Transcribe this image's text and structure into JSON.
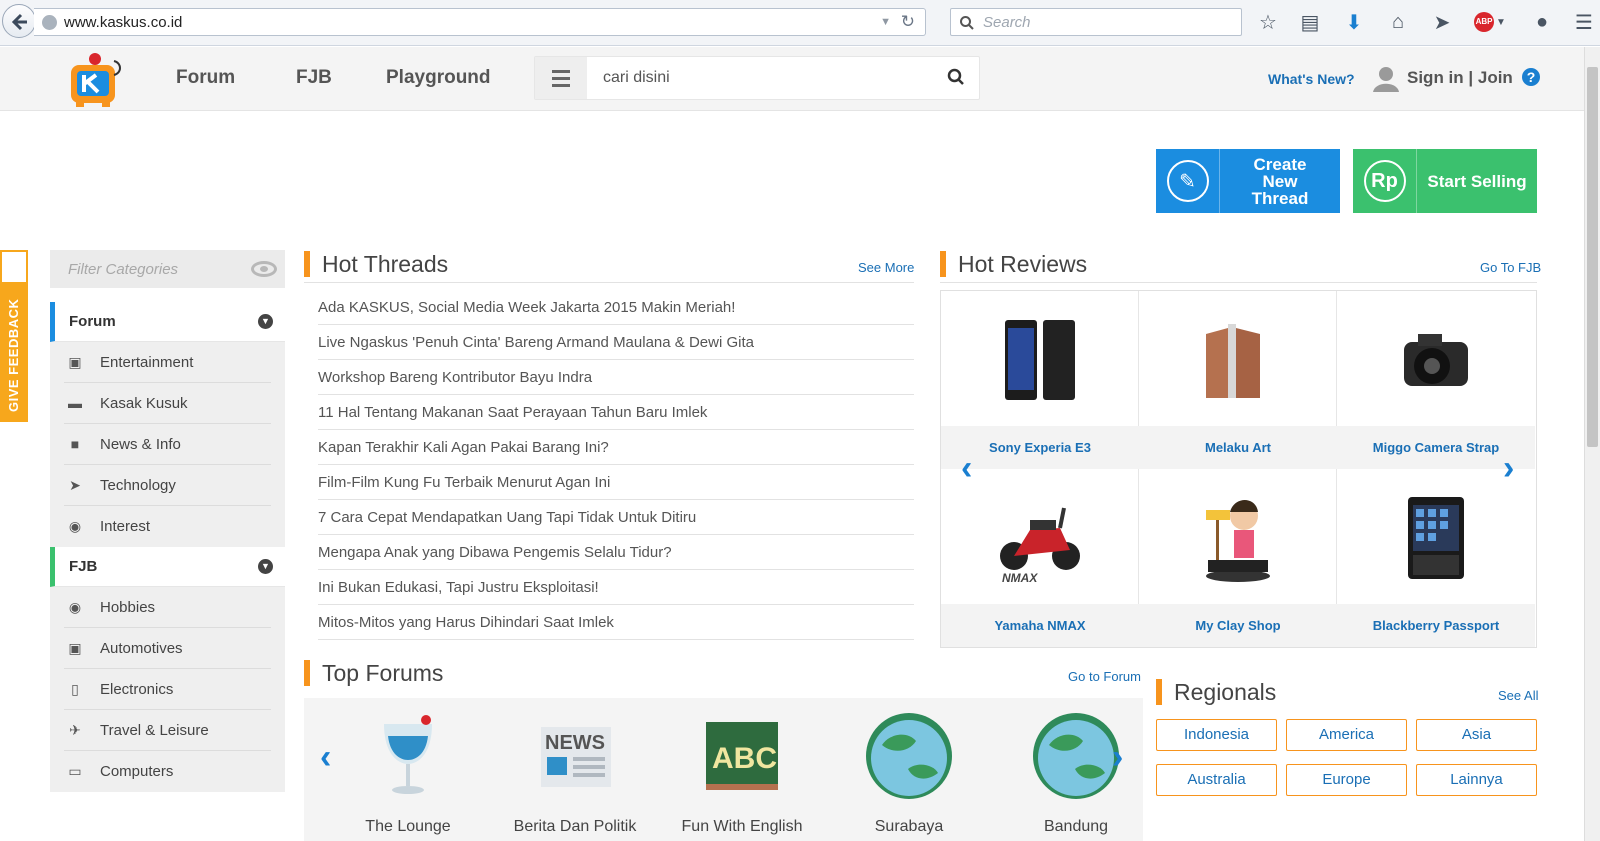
{
  "browser": {
    "url": "www.kaskus.co.id",
    "search_placeholder": "Search"
  },
  "header": {
    "nav": [
      "Forum",
      "FJB",
      "Playground"
    ],
    "search_placeholder": "cari disini",
    "whats_new": "What's New?",
    "signin": "Sign in | Join",
    "help": "?"
  },
  "actions": {
    "create_thread": "Create New Thread",
    "start_selling": "Start Selling",
    "sell_icon_text": "Rp"
  },
  "feedback": "GIVE FEEDBACK",
  "sidebar": {
    "filter_placeholder": "Filter Categories",
    "groups": [
      {
        "label": "Forum",
        "accent": "#1b8de0",
        "items": [
          {
            "label": "Entertainment",
            "icon": "tv-icon"
          },
          {
            "label": "Kasak Kusuk",
            "icon": "chat-icon"
          },
          {
            "label": "News & Info",
            "icon": "briefcase-icon"
          },
          {
            "label": "Technology",
            "icon": "rocket-icon"
          },
          {
            "label": "Interest",
            "icon": "palette-icon"
          }
        ]
      },
      {
        "label": "FJB",
        "accent": "#3bc16e",
        "items": [
          {
            "label": "Hobbies",
            "icon": "palette-icon"
          },
          {
            "label": "Automotives",
            "icon": "car-icon"
          },
          {
            "label": "Electronics",
            "icon": "device-icon"
          },
          {
            "label": "Travel & Leisure",
            "icon": "plane-icon"
          },
          {
            "label": "Computers",
            "icon": "monitor-icon"
          }
        ]
      }
    ]
  },
  "hot_threads": {
    "title": "Hot Threads",
    "link": "See More",
    "items": [
      "Ada KASKUS, Social Media Week Jakarta 2015 Makin Meriah!",
      "Live Ngaskus 'Penuh Cinta' Bareng Armand Maulana & Dewi Gita",
      "Workshop Bareng Kontributor Bayu Indra",
      "11 Hal Tentang Makanan Saat Perayaan Tahun Baru Imlek",
      "Kapan Terakhir Kali Agan Pakai Barang Ini?",
      "Film-Film Kung Fu Terbaik Menurut Agan Ini",
      "7 Cara Cepat Mendapatkan Uang Tapi Tidak Untuk Ditiru",
      "Mengapa Anak yang Dibawa Pengemis Selalu Tidur?",
      "Ini Bukan Edukasi, Tapi Justru Eksploitasi!",
      "Mitos-Mitos yang Harus Dihindari Saat Imlek"
    ]
  },
  "hot_reviews": {
    "title": "Hot Reviews",
    "link": "Go To FJB",
    "items": [
      {
        "name": "Sony Experia E3",
        "icon": "smartphone-icon"
      },
      {
        "name": "Melaku Art",
        "icon": "laptop-stand-icon"
      },
      {
        "name": "Miggo Camera Strap",
        "icon": "camera-icon"
      },
      {
        "name": "Yamaha NMAX",
        "icon": "scooter-icon"
      },
      {
        "name": "My Clay Shop",
        "icon": "clay-figure-icon"
      },
      {
        "name": "Blackberry Passport",
        "icon": "blackberry-icon"
      }
    ]
  },
  "top_forums": {
    "title": "Top Forums",
    "link": "Go to Forum",
    "items": [
      {
        "name": "The Lounge",
        "icon": "glass-icon"
      },
      {
        "name": "Berita Dan Politik",
        "icon": "newspaper-icon"
      },
      {
        "name": "Fun With English",
        "icon": "chalkboard-icon"
      },
      {
        "name": "Surabaya",
        "icon": "globe-icon"
      },
      {
        "name": "Bandung",
        "icon": "globe-icon"
      }
    ]
  },
  "regionals": {
    "title": "Regionals",
    "link": "See All",
    "items": [
      "Indonesia",
      "America",
      "Asia",
      "Australia",
      "Europe",
      "Lainnya"
    ]
  },
  "colors": {
    "accent_orange": "#f7941d",
    "link_blue": "#1a6fb5",
    "create_blue": "#1b8de0",
    "sell_green": "#3bc16e"
  }
}
